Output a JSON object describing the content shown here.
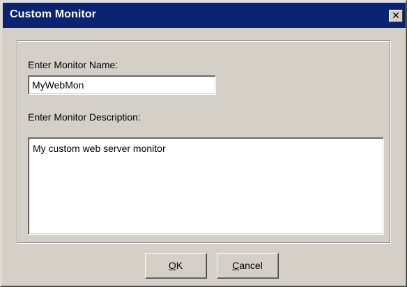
{
  "window": {
    "title": "Custom Monitor",
    "close_glyph": "✕",
    "close_icon": "close-icon"
  },
  "form": {
    "name_label": "Enter Monitor Name:",
    "name_value": "MyWebMon",
    "description_label": "Enter Monitor Description:",
    "description_value": "My custom web server monitor"
  },
  "buttons": {
    "ok": {
      "mnemonic": "O",
      "rest": "K"
    },
    "cancel": {
      "mnemonic": "C",
      "rest": "ancel"
    }
  },
  "colors": {
    "titlebar": "#0a2472",
    "face": "#d4d0c8"
  }
}
